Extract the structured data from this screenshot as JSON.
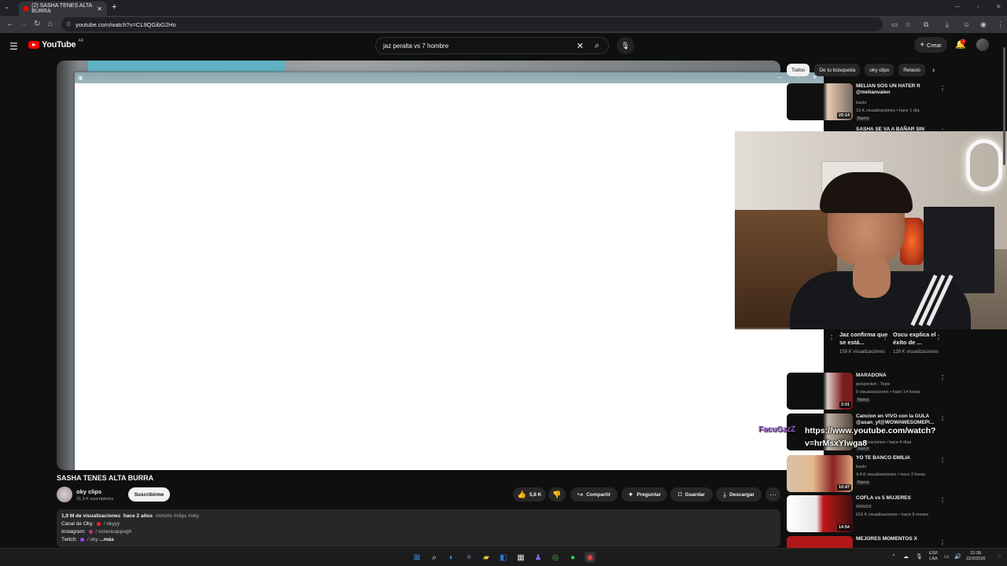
{
  "browser": {
    "tab_title": "(2) SASHA TENES ALTA BURRA",
    "url": "youtube.com/watch?v=CL9QGibG2Ho"
  },
  "youtube": {
    "logo_text": "YouTube",
    "logo_region": "AR",
    "search_value": "jaz peralta vs 7 hombre",
    "create_label": "Crear",
    "notification_count": "2"
  },
  "filter_chips": [
    "Todos",
    "De tu búsqueda",
    "oky clips",
    "Relacio"
  ],
  "video": {
    "title": "SASHA TENES ALTA BURRA",
    "channel": "oky clips",
    "subscribers": "31,3 K suscriptores",
    "subscribe_label": "Suscribirme",
    "likes": "5,8 K",
    "share_label": "Compartir",
    "ask_label": "Preguntar",
    "save_label": "Guardar",
    "download_label": "Descargar",
    "views": "1,9 M de visualizaciones",
    "age": "hace 2 años",
    "tags": "#shorts #clips #oky",
    "desc_line1_label": "Canal de Oky:",
    "desc_line1_link": "/ okyyy",
    "desc_line2_label": "Instagram:",
    "desc_line2_link": "/ octavioappogh",
    "desc_line3_label": "Twitch:",
    "desc_line3_link": "/ oky",
    "more_label": "...más"
  },
  "recommendations": [
    {
      "title": "MELIAN SOS UN HATER ft @melianvalen",
      "channel": "baulo",
      "meta": "10 K visualizaciones • hace 1 día",
      "badge": "Nuevo",
      "duration": "20:14"
    },
    {
      "title": "SASHA SE VA A BAÑAR SIN",
      "channel": "",
      "meta": "",
      "badge": "",
      "duration": ""
    },
    {
      "title": "MARADONA",
      "channel": "pickpocket - Topic",
      "meta": "0 visualizaciones • hace 14 horas",
      "badge": "Nuevo",
      "duration": "2:01"
    },
    {
      "title": "Cancion en VIVO con la GULA @asan_yf@WOWAWESOMEPI...",
      "channel": "",
      "meta": "visualizaciones • hace 4 días",
      "badge": "Nuevo",
      "duration": ""
    },
    {
      "title": "YO TE BANCO EMILIA",
      "channel": "baulo",
      "meta": "4,4 K visualizaciones • hace 3 horas",
      "badge": "Nuevo",
      "duration": "10:47"
    },
    {
      "title": "COFLA vs 5 MUJERES",
      "channel": "WANDII",
      "meta": "616 K visualizaciones • hace 9 meses",
      "badge": "",
      "duration": "14:54"
    },
    {
      "title": "MEJORES MOMENTOS X",
      "channel": "",
      "meta": "",
      "badge": "",
      "duration": ""
    }
  ],
  "shorts": [
    {
      "title": "Jaz confirma que se está...",
      "views": "159 K visualizaciones"
    },
    {
      "title": "Oscu explica el éxito de ...",
      "views": "129 K visualizaciones"
    }
  ],
  "chat_overlay": {
    "username": "FacuGzzZ",
    "message": "https://www.youtube.com/watch?v=hrMsxYlwga8"
  },
  "taskbar": {
    "lang_line1": "ESP",
    "lang_line2": "LAA",
    "time": "21:39",
    "date": "22/3/2026"
  }
}
